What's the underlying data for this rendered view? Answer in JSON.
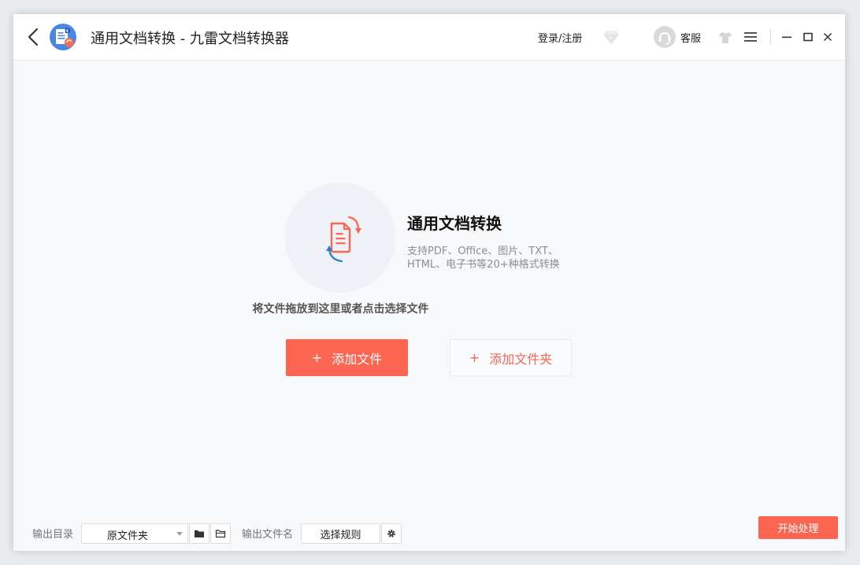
{
  "titlebar": {
    "title": "通用文档转换 - 九雷文档转换器",
    "login": "登录/注册",
    "service": "客服"
  },
  "hero": {
    "title": "通用文档转换",
    "desc": "支持PDF、Office、图片、TXT、HTML、电子书等20+种格式转换",
    "drop_hint": "将文件拖放到这里或者点击选择文件",
    "add_file": "添加文件",
    "add_folder": "添加文件夹",
    "plus": "+"
  },
  "bottom": {
    "out_dir_label": "输出目录",
    "out_dir_value": "原文件夹",
    "out_name_label": "输出文件名",
    "rule_button": "选择规则",
    "start_button": "开始处理"
  },
  "colors": {
    "accent": "#fc6552",
    "icon_blue": "#2e7bd6",
    "logo_blue": "#3b6fd8"
  },
  "icons": {
    "back": "chevron-left-icon",
    "logo": "app-logo",
    "vip": "diamond-icon",
    "skin": "tshirt-icon",
    "menu": "hamburger-icon",
    "minimize": "minimize-icon",
    "maximize": "maximize-icon",
    "close": "close-icon",
    "hero": "document-convert-icon",
    "open_folder": "folder-icon",
    "browse_folder": "folder-outline-icon",
    "settings": "gear-icon"
  }
}
